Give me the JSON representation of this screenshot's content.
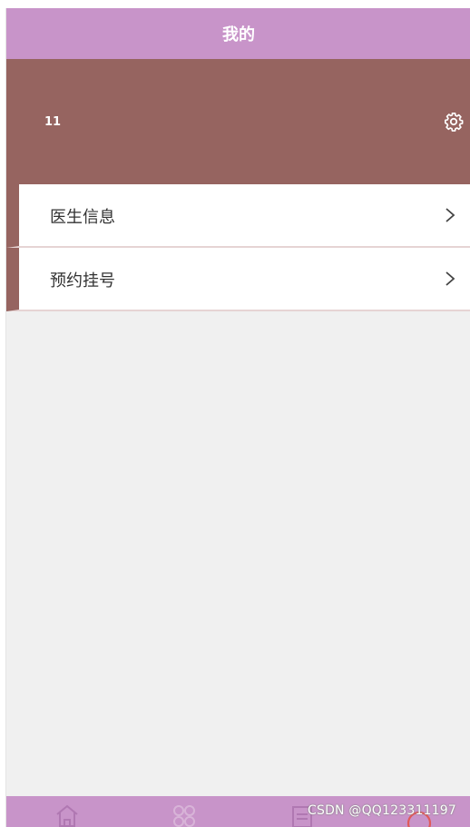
{
  "header": {
    "title": "我的"
  },
  "profile": {
    "username": "11",
    "settings_icon": "gear-icon"
  },
  "menu": {
    "items": [
      {
        "label": "医生信息",
        "icon": "chevron-right-icon"
      },
      {
        "label": "预约挂号",
        "icon": "chevron-right-icon"
      }
    ]
  },
  "tabbar": {
    "tabs": [
      {
        "icon": "home-icon"
      },
      {
        "icon": "grid-icon"
      },
      {
        "icon": "document-icon"
      },
      {
        "icon": "user-icon"
      }
    ]
  },
  "watermark": {
    "text": "CSDN @QQ123311197"
  },
  "colors": {
    "titlebar": "#c894c9",
    "profile_bg": "#966460",
    "page_bg": "#f0f0f0",
    "accent": "#e05a5a"
  }
}
